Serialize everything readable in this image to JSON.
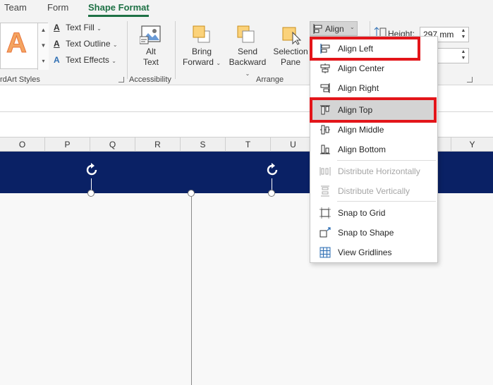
{
  "tabs": [
    {
      "label": "Team",
      "active": false
    },
    {
      "label": "Form",
      "active": false
    },
    {
      "label": "Shape Format",
      "active": true
    }
  ],
  "ribbon": {
    "wordart": {
      "gallery_glyph": "A",
      "text_fill": "Text Fill",
      "text_outline": "Text Outline",
      "text_effects": "Text Effects",
      "group_label": "rdArt Styles"
    },
    "accessibility": {
      "alt_text_line1": "Alt",
      "alt_text_line2": "Text",
      "group_label": "Accessibility"
    },
    "arrange": {
      "bring_forward_line1": "Bring",
      "bring_forward_line2": "Forward",
      "send_backward_line1": "Send",
      "send_backward_line2": "Backward",
      "selection_pane_line1": "Selection",
      "selection_pane_line2": "Pane",
      "align_label": "Align",
      "group_label": "Arrange"
    },
    "size": {
      "height_label": "Height:",
      "height_value": "297 mm",
      "width_value": ""
    }
  },
  "columns": [
    "O",
    "P",
    "Q",
    "R",
    "S",
    "T",
    "U",
    "Y"
  ],
  "align_menu": {
    "items": [
      {
        "label": "Align Left",
        "icon": "align-left-icon",
        "disabled": false,
        "highlighted": true
      },
      {
        "label": "Align Center",
        "icon": "align-center-icon",
        "disabled": false
      },
      {
        "label": "Align Right",
        "icon": "align-right-icon",
        "disabled": false
      },
      {
        "label": "Align Top",
        "icon": "align-top-icon",
        "disabled": false,
        "hovered": true,
        "highlighted": true
      },
      {
        "label": "Align Middle",
        "icon": "align-middle-icon",
        "disabled": false
      },
      {
        "label": "Align Bottom",
        "icon": "align-bottom-icon",
        "disabled": false
      },
      {
        "label": "Distribute Horizontally",
        "icon": "distribute-horizontally-icon",
        "disabled": true
      },
      {
        "label": "Distribute Vertically",
        "icon": "distribute-vertically-icon",
        "disabled": true
      },
      {
        "label": "Snap to Grid",
        "icon": "snap-to-grid-icon",
        "disabled": false
      },
      {
        "label": "Snap to Shape",
        "icon": "snap-to-shape-icon",
        "disabled": false
      },
      {
        "label": "View Gridlines",
        "icon": "view-gridlines-icon",
        "disabled": false
      }
    ]
  },
  "colors": {
    "accent_green": "#1e7145",
    "shape_band_navy": "#0a2165",
    "highlight_red": "#e3151a",
    "menu_hover": "#d4d4d4"
  }
}
